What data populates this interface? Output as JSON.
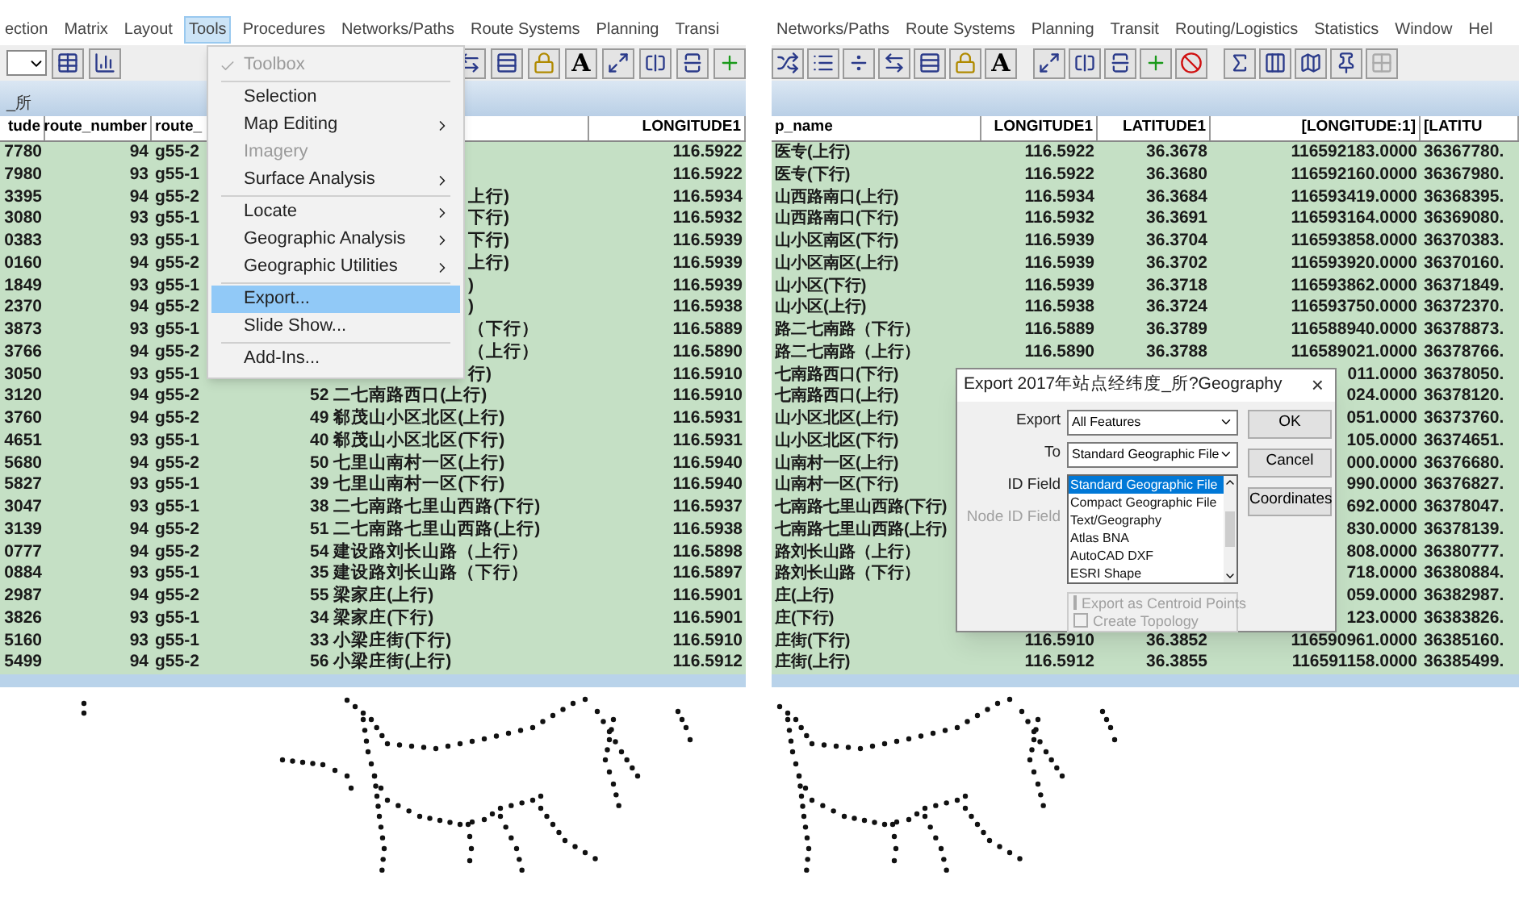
{
  "left_window": {
    "menu_bar": [
      {
        "label": "ection",
        "selected": false
      },
      {
        "label": "Matrix",
        "selected": false
      },
      {
        "label": "Layout",
        "selected": false
      },
      {
        "label": "Tools",
        "selected": true
      },
      {
        "label": "Procedures",
        "selected": false
      },
      {
        "label": "Networks/Paths",
        "selected": false
      },
      {
        "label": "Route Systems",
        "selected": false
      },
      {
        "label": "Planning",
        "selected": false
      },
      {
        "label": "Transi",
        "selected": false
      }
    ],
    "toolbar_letter": "A",
    "title": "_所",
    "table": {
      "columns": [
        "tude",
        "route_number",
        "route_",
        null,
        "LONGITUDE1"
      ],
      "rows": [
        [
          "7780",
          "94",
          "g55-2",
          null,
          "116.5922"
        ],
        [
          "7980",
          "93",
          "g55-1",
          null,
          "116.5922"
        ],
        [
          "3395",
          "94",
          "g55-2",
          "上行)",
          "116.5934"
        ],
        [
          "3080",
          "93",
          "g55-1",
          "下行)",
          "116.5932"
        ],
        [
          "0383",
          "93",
          "g55-1",
          "下行)",
          "116.5939"
        ],
        [
          "0160",
          "94",
          "g55-2",
          "上行)",
          "116.5939"
        ],
        [
          "1849",
          "93",
          "g55-1",
          ")",
          "116.5939"
        ],
        [
          "2370",
          "94",
          "g55-2",
          ")",
          "116.5938"
        ],
        [
          "3873",
          "93",
          "g55-1",
          "（下行）",
          "116.5889"
        ],
        [
          "3766",
          "94",
          "g55-2",
          "（上行）",
          "116.5890"
        ],
        [
          "3050",
          "93",
          "g55-1",
          "行)",
          "116.5910"
        ],
        [
          "3120",
          "94",
          "g55-2",
          "52 二七南路西口(上行)",
          "116.5910"
        ],
        [
          "3760",
          "94",
          "g55-2",
          "49 郗茂山小区北区(上行)",
          "116.5931"
        ],
        [
          "4651",
          "93",
          "g55-1",
          "40 郗茂山小区北区(下行)",
          "116.5931"
        ],
        [
          "5680",
          "94",
          "g55-2",
          "50 七里山南村一区(上行)",
          "116.5940"
        ],
        [
          "5827",
          "93",
          "g55-1",
          "39 七里山南村一区(下行)",
          "116.5940"
        ],
        [
          "3047",
          "93",
          "g55-1",
          "38 二七南路七里山西路(下行)",
          "116.5937"
        ],
        [
          "3139",
          "94",
          "g55-2",
          "51 二七南路七里山西路(上行)",
          "116.5938"
        ],
        [
          "0777",
          "94",
          "g55-2",
          "54 建设路刘长山路（上行）",
          "116.5898"
        ],
        [
          "0884",
          "93",
          "g55-1",
          "35 建设路刘长山路（下行）",
          "116.5897"
        ],
        [
          "2987",
          "94",
          "g55-2",
          "55 梁家庄(上行)",
          "116.5901"
        ],
        [
          "3826",
          "93",
          "g55-1",
          "34 梁家庄(下行)",
          "116.5901"
        ],
        [
          "5160",
          "93",
          "g55-1",
          "33 小梁庄街(下行)",
          "116.5910"
        ],
        [
          "5499",
          "94",
          "g55-2",
          "56 小梁庄街(上行)",
          "116.5912"
        ]
      ]
    },
    "tools_menu": [
      {
        "kind": "item",
        "label": "Toolbox",
        "checked": true,
        "disabled": true,
        "submenu": false,
        "selected": false
      },
      {
        "kind": "separator"
      },
      {
        "kind": "item",
        "label": "Selection",
        "checked": false,
        "disabled": false,
        "submenu": false,
        "selected": false
      },
      {
        "kind": "item",
        "label": "Map Editing",
        "checked": false,
        "disabled": false,
        "submenu": true,
        "selected": false
      },
      {
        "kind": "item",
        "label": "Imagery",
        "checked": false,
        "disabled": true,
        "submenu": false,
        "selected": false
      },
      {
        "kind": "item",
        "label": "Surface Analysis",
        "checked": false,
        "disabled": false,
        "submenu": true,
        "selected": false
      },
      {
        "kind": "separator"
      },
      {
        "kind": "item",
        "label": "Locate",
        "checked": false,
        "disabled": false,
        "submenu": true,
        "selected": false
      },
      {
        "kind": "item",
        "label": "Geographic Analysis",
        "checked": false,
        "disabled": false,
        "submenu": true,
        "selected": false
      },
      {
        "kind": "item",
        "label": "Geographic Utilities",
        "checked": false,
        "disabled": false,
        "submenu": true,
        "selected": false
      },
      {
        "kind": "separator"
      },
      {
        "kind": "item",
        "label": "Export...",
        "checked": false,
        "disabled": false,
        "submenu": false,
        "selected": true
      },
      {
        "kind": "item",
        "label": "Slide Show...",
        "checked": false,
        "disabled": false,
        "submenu": false,
        "selected": false
      },
      {
        "kind": "separator"
      },
      {
        "kind": "item",
        "label": "Add-Ins...",
        "checked": false,
        "disabled": false,
        "submenu": false,
        "selected": false
      }
    ]
  },
  "right_window": {
    "menu_bar": [
      {
        "label": "Networks/Paths",
        "selected": false
      },
      {
        "label": "Route Systems",
        "selected": false
      },
      {
        "label": "Planning",
        "selected": false
      },
      {
        "label": "Transit",
        "selected": false
      },
      {
        "label": "Routing/Logistics",
        "selected": false
      },
      {
        "label": "Statistics",
        "selected": false
      },
      {
        "label": "Window",
        "selected": false
      },
      {
        "label": "Hel",
        "selected": false
      }
    ],
    "toolbar_letter": "A",
    "table": {
      "columns": [
        "p_name",
        "LONGITUDE1",
        "LATITUDE1",
        "[LONGITUDE:1]",
        "[LATITU"
      ],
      "rows": [
        [
          "医专(上行)",
          "116.5922",
          "36.3678",
          "116592183.0000",
          "36367780."
        ],
        [
          "医专(下行)",
          "116.5922",
          "36.3680",
          "116592160.0000",
          "36367980."
        ],
        [
          "山西路南口(上行)",
          "116.5934",
          "36.3684",
          "116593419.0000",
          "36368395."
        ],
        [
          "山西路南口(下行)",
          "116.5932",
          "36.3691",
          "116593164.0000",
          "36369080."
        ],
        [
          "山小区南区(下行)",
          "116.5939",
          "36.3704",
          "116593858.0000",
          "36370383."
        ],
        [
          "山小区南区(上行)",
          "116.5939",
          "36.3702",
          "116593920.0000",
          "36370160."
        ],
        [
          "山小区(下行)",
          "116.5939",
          "36.3718",
          "116593862.0000",
          "36371849."
        ],
        [
          "山小区(上行)",
          "116.5938",
          "36.3724",
          "116593750.0000",
          "36372370."
        ],
        [
          "路二七南路（下行）",
          "116.5889",
          "36.3789",
          "116588940.0000",
          "36378873."
        ],
        [
          "路二七南路（上行）",
          "116.5890",
          "36.3788",
          "116589021.0000",
          "36378766."
        ],
        [
          "七南路西口(下行)",
          null,
          null,
          "011.0000",
          "36378050."
        ],
        [
          "七南路西口(上行)",
          null,
          null,
          "024.0000",
          "36378120."
        ],
        [
          "山小区北区(上行)",
          null,
          null,
          "051.0000",
          "36373760."
        ],
        [
          "山小区北区(下行)",
          null,
          null,
          "105.0000",
          "36374651."
        ],
        [
          "山南村一区(上行)",
          null,
          null,
          "000.0000",
          "36376680."
        ],
        [
          "山南村一区(下行)",
          null,
          null,
          "990.0000",
          "36376827."
        ],
        [
          "七南路七里山西路(下行)",
          null,
          null,
          "692.0000",
          "36378047."
        ],
        [
          "七南路七里山西路(上行)",
          null,
          null,
          "830.0000",
          "36378139."
        ],
        [
          "路刘长山路（上行）",
          null,
          null,
          "808.0000",
          "36380777."
        ],
        [
          "路刘长山路（下行）",
          null,
          null,
          "718.0000",
          "36380884."
        ],
        [
          "庄(上行)",
          null,
          null,
          "059.0000",
          "36382987."
        ],
        [
          "庄(下行)",
          null,
          null,
          "123.0000",
          "36383826."
        ],
        [
          "庄街(下行)",
          "116.5910",
          "36.3852",
          "116590961.0000",
          "36385160."
        ],
        [
          "庄街(上行)",
          "116.5912",
          "36.3855",
          "116591158.0000",
          "36385499."
        ]
      ]
    },
    "export_dialog": {
      "title": "Export 2017年站点经纬度_所?Geography",
      "close": "×",
      "fields": [
        {
          "kind": "select",
          "label": "Export",
          "value": "All Features",
          "disabled": false
        },
        {
          "kind": "select",
          "label": "To",
          "value": "Standard Geographic File",
          "disabled": false
        },
        {
          "kind": "label",
          "label": "ID Field",
          "disabled": false
        },
        {
          "kind": "label",
          "label": "Node ID Field",
          "disabled": true
        }
      ],
      "buttons": [
        "OK",
        "Cancel",
        "Coordinates"
      ],
      "dropdown_list": [
        {
          "label": "Standard Geographic File",
          "selected": true
        },
        {
          "label": "Compact Geographic File",
          "selected": false
        },
        {
          "label": "Text/Geography",
          "selected": false
        },
        {
          "label": "Atlas BNA",
          "selected": false
        },
        {
          "label": "AutoCAD DXF",
          "selected": false
        },
        {
          "label": "ESRI Shape",
          "selected": false
        }
      ],
      "options": [
        {
          "label": "Export as Centroid Points",
          "checked": false,
          "disabled": true
        },
        {
          "label": "Create Topology",
          "checked": false,
          "disabled": true
        }
      ]
    }
  }
}
